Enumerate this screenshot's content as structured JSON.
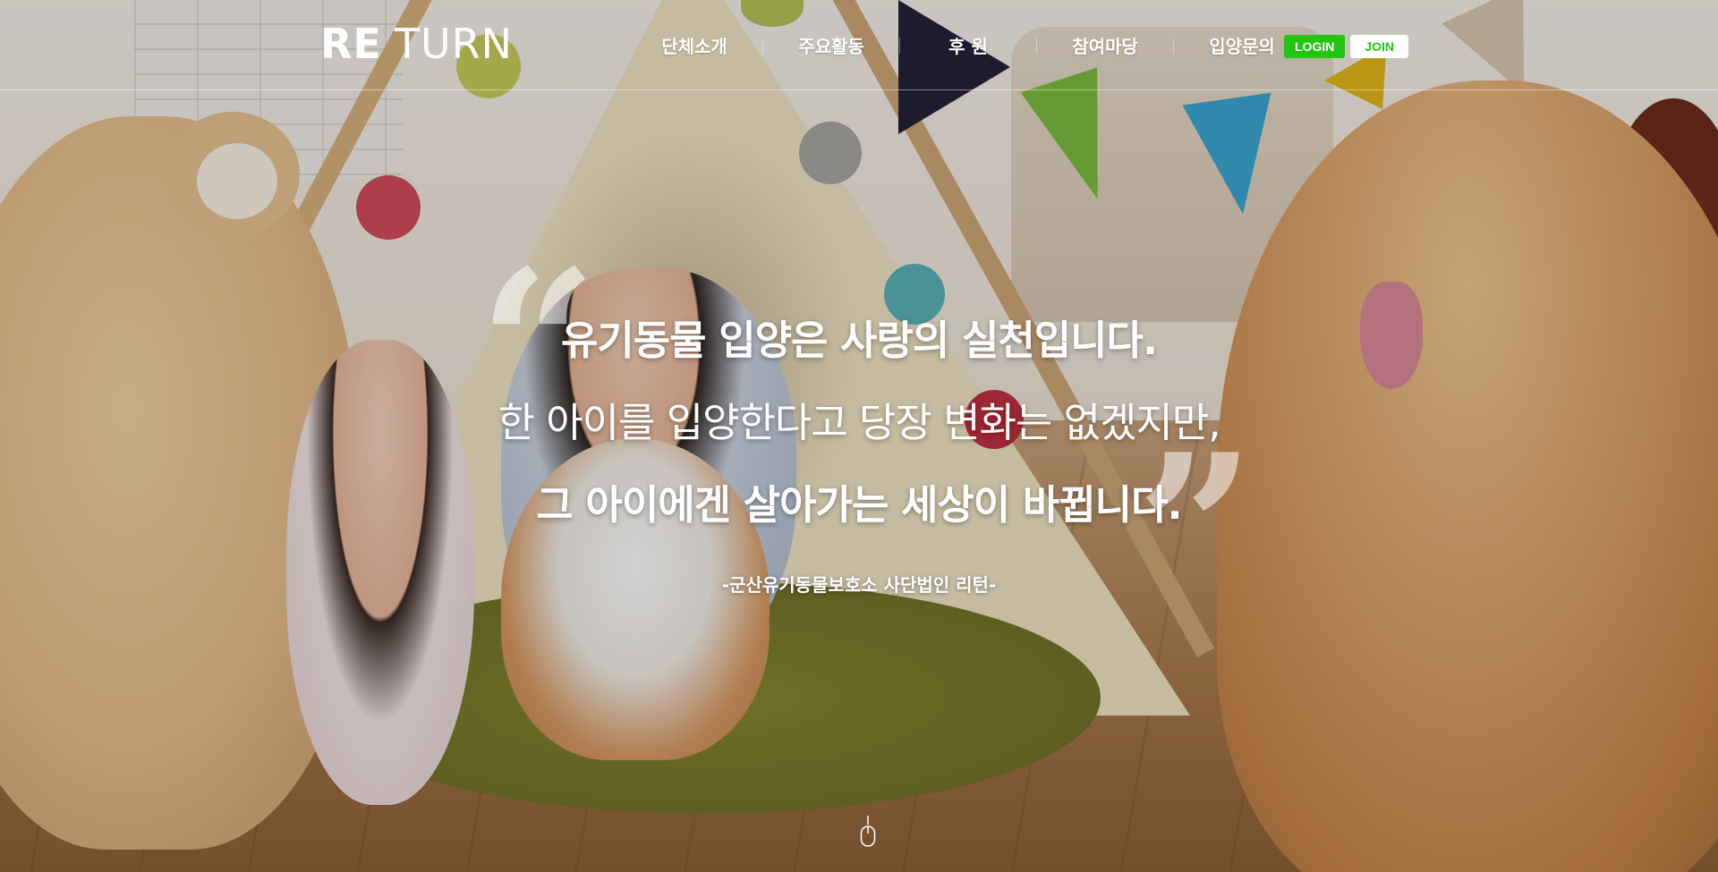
{
  "brand": {
    "logo_bold": "RE",
    "logo_light": "TURN"
  },
  "nav": {
    "items": [
      {
        "label": "단체소개"
      },
      {
        "label": "주요활동"
      },
      {
        "label": "후 원"
      },
      {
        "label": "참여마당"
      },
      {
        "label": "입양문의"
      }
    ]
  },
  "auth": {
    "login_label": "LOGIN",
    "join_label": "JOIN"
  },
  "hero": {
    "line1": "유기동물 입양은 사랑의 실천입니다.",
    "line2": "한 아이를 입양한다고 당장 변화는 없겠지만,",
    "line3": "그 아이에겐 살아가는 세상이 바뀝니다.",
    "source": "-군산유기동물보호소 사단법인 리턴-"
  },
  "colors": {
    "login_bg": "#23c412",
    "join_text": "#23c412"
  },
  "icons": {
    "scroll": "mouse-scroll-icon",
    "open_quote": "open-quote-icon",
    "close_quote": "close-quote-icon"
  }
}
